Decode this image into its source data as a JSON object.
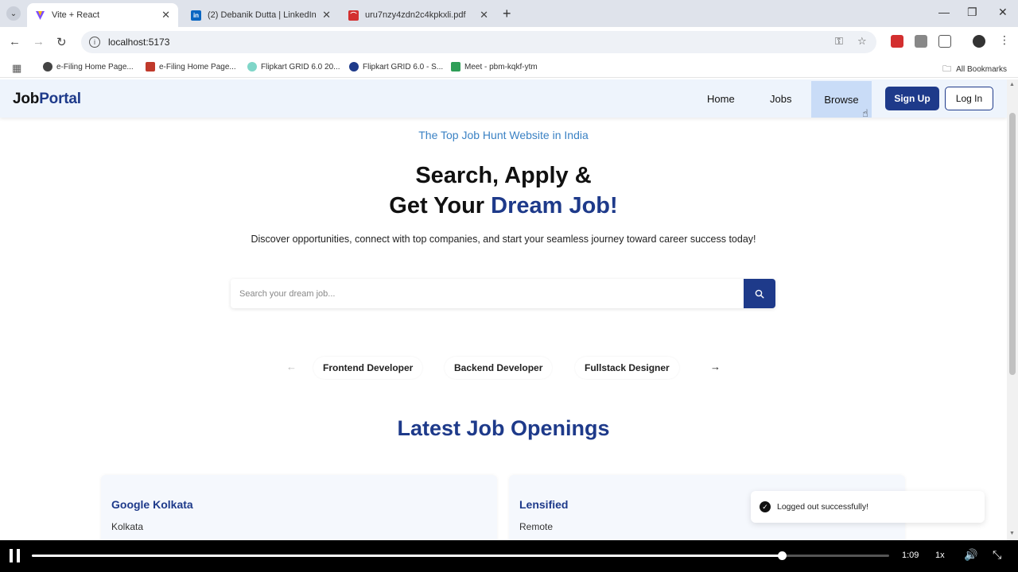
{
  "browser": {
    "tabs": [
      {
        "title": "Vite + React",
        "favicon_color": "#7c4dff",
        "active": true
      },
      {
        "title": "(2) Debanik Dutta | LinkedIn",
        "favicon_color": "#0a66c2",
        "active": false
      },
      {
        "title": "uru7nzy4zdn2c4kpkxli.pdf",
        "favicon_color": "#d32f2f",
        "active": false
      }
    ],
    "new_tab": "+",
    "url": "localhost:5173",
    "bookmarks": [
      {
        "label": "e-Filing Home Page...",
        "color": "#444444"
      },
      {
        "label": "e-Filing Home Page...",
        "color": "#c0392b"
      },
      {
        "label": "Flipkart GRID 6.0 20...",
        "color": "#7fd6c8"
      },
      {
        "label": "Flipkart GRID 6.0 - S...",
        "color": "#1e3a8a"
      },
      {
        "label": "Meet - pbm-kqkf-ytm",
        "color": "#2e9e57"
      }
    ],
    "all_bookmarks": "All Bookmarks"
  },
  "site": {
    "logo_part1": "Job",
    "logo_part2": "Portal",
    "nav": {
      "home": "Home",
      "jobs": "Jobs",
      "browse": "Browse"
    },
    "signup": "Sign Up",
    "login": "Log In",
    "tagline": "The Top Job Hunt Website in India",
    "hero_line1": "Search, Apply &",
    "hero_line2_prefix": "Get Your ",
    "hero_line2_accent": "Dream Job!",
    "subtext": "Discover opportunities, connect with top companies, and start your seamless journey toward career success today!",
    "search_placeholder": "Search your dream job...",
    "categories": [
      "Frontend Developer",
      "Backend Developer",
      "Fullstack Designer"
    ],
    "section_title": "Latest Job Openings",
    "jobs": [
      {
        "company": "Google Kolkata",
        "location": "Kolkata"
      },
      {
        "company": "Lensified",
        "location": "Remote"
      }
    ],
    "toast": "Logged out successfully!",
    "colors": {
      "primary": "#1e3a8a",
      "accent": "#3b82c4",
      "navbar_bg": "#eef4fc",
      "browse_highlight": "#c9dcf7"
    }
  },
  "player": {
    "time": "1:09",
    "speed": "1x",
    "progress": 0.875
  }
}
